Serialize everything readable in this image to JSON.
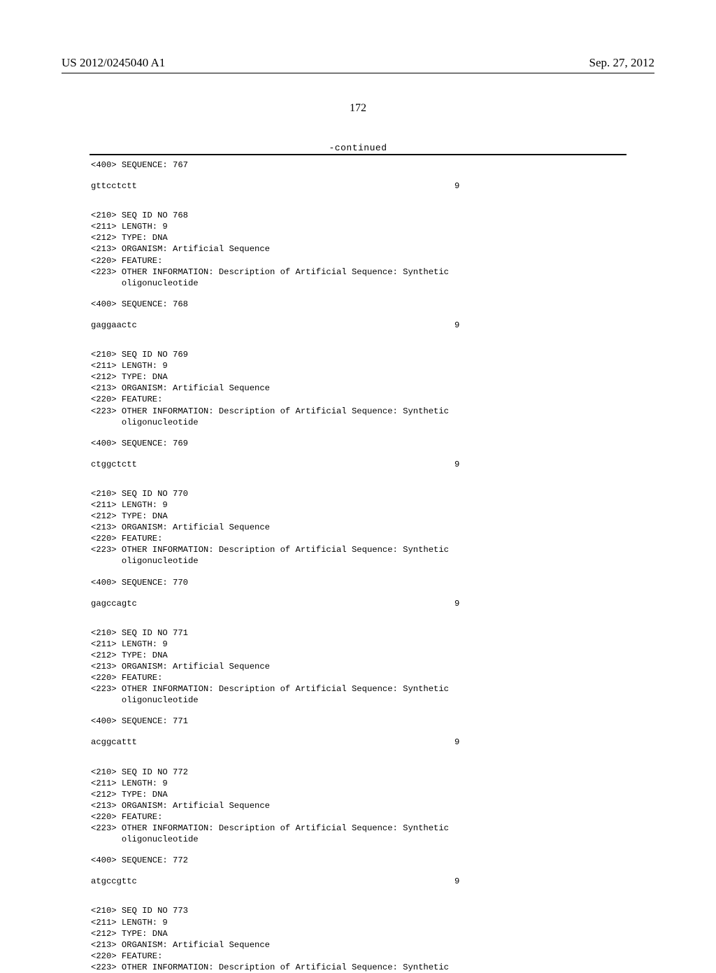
{
  "header": {
    "publication_number": "US 2012/0245040 A1",
    "date": "Sep. 27, 2012"
  },
  "page_number": "172",
  "continued_label": "-continued",
  "entries": [
    {
      "pre_400": "<400> SEQUENCE: 767",
      "seq": "gttcctctt",
      "len": "9",
      "block": null
    },
    {
      "block": {
        "id": "768",
        "lines": [
          "<210> SEQ ID NO 768",
          "<211> LENGTH: 9",
          "<212> TYPE: DNA",
          "<213> ORGANISM: Artificial Sequence",
          "<220> FEATURE:",
          "<223> OTHER INFORMATION: Description of Artificial Sequence: Synthetic",
          "      oligonucleotide"
        ]
      },
      "pre_400": "<400> SEQUENCE: 768",
      "seq": "gaggaactc",
      "len": "9"
    },
    {
      "block": {
        "id": "769",
        "lines": [
          "<210> SEQ ID NO 769",
          "<211> LENGTH: 9",
          "<212> TYPE: DNA",
          "<213> ORGANISM: Artificial Sequence",
          "<220> FEATURE:",
          "<223> OTHER INFORMATION: Description of Artificial Sequence: Synthetic",
          "      oligonucleotide"
        ]
      },
      "pre_400": "<400> SEQUENCE: 769",
      "seq": "ctggctctt",
      "len": "9"
    },
    {
      "block": {
        "id": "770",
        "lines": [
          "<210> SEQ ID NO 770",
          "<211> LENGTH: 9",
          "<212> TYPE: DNA",
          "<213> ORGANISM: Artificial Sequence",
          "<220> FEATURE:",
          "<223> OTHER INFORMATION: Description of Artificial Sequence: Synthetic",
          "      oligonucleotide"
        ]
      },
      "pre_400": "<400> SEQUENCE: 770",
      "seq": "gagccagtc",
      "len": "9"
    },
    {
      "block": {
        "id": "771",
        "lines": [
          "<210> SEQ ID NO 771",
          "<211> LENGTH: 9",
          "<212> TYPE: DNA",
          "<213> ORGANISM: Artificial Sequence",
          "<220> FEATURE:",
          "<223> OTHER INFORMATION: Description of Artificial Sequence: Synthetic",
          "      oligonucleotide"
        ]
      },
      "pre_400": "<400> SEQUENCE: 771",
      "seq": "acggcattt",
      "len": "9"
    },
    {
      "block": {
        "id": "772",
        "lines": [
          "<210> SEQ ID NO 772",
          "<211> LENGTH: 9",
          "<212> TYPE: DNA",
          "<213> ORGANISM: Artificial Sequence",
          "<220> FEATURE:",
          "<223> OTHER INFORMATION: Description of Artificial Sequence: Synthetic",
          "      oligonucleotide"
        ]
      },
      "pre_400": "<400> SEQUENCE: 772",
      "seq": "atgccgttc",
      "len": "9"
    },
    {
      "block": {
        "id": "773",
        "lines": [
          "<210> SEQ ID NO 773",
          "<211> LENGTH: 9",
          "<212> TYPE: DNA",
          "<213> ORGANISM: Artificial Sequence",
          "<220> FEATURE:",
          "<223> OTHER INFORMATION: Description of Artificial Sequence: Synthetic"
        ]
      },
      "pre_400": null,
      "seq": null,
      "len": null
    }
  ]
}
